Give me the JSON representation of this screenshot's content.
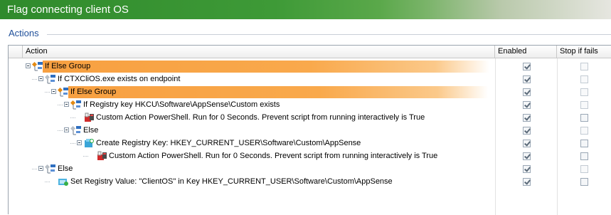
{
  "window": {
    "title": "Flag connecting client OS"
  },
  "section": {
    "label": "Actions"
  },
  "columns": {
    "action": "Action",
    "enabled": "Enabled",
    "stop_if_fails": "Stop if fails"
  },
  "rows": [
    {
      "label": "If Else Group",
      "icon": "if-else-group-icon",
      "highlighted": true,
      "enabled": true,
      "stop_if_fails": false
    },
    {
      "label": "If CTXCliOS.exe exists on endpoint",
      "icon": "condition-icon",
      "highlighted": false,
      "enabled": true,
      "stop_if_fails": false
    },
    {
      "label": "If Else Group",
      "icon": "if-else-group-icon",
      "highlighted": true,
      "enabled": true,
      "stop_if_fails": false
    },
    {
      "label": "If Registry key HKCU\\Software\\AppSense\\Custom exists",
      "icon": "registry-condition-icon",
      "highlighted": false,
      "enabled": true,
      "stop_if_fails": false
    },
    {
      "label": "Custom Action PowerShell. Run for 0 Seconds. Prevent script from running interactively is True",
      "icon": "powershell-icon",
      "highlighted": false,
      "enabled": true,
      "stop_if_fails": false
    },
    {
      "label": "Else",
      "icon": "else-icon",
      "highlighted": false,
      "enabled": true,
      "stop_if_fails": false
    },
    {
      "label": "Create Registry Key: HKEY_CURRENT_USER\\Software\\Custom\\AppSense",
      "icon": "registry-key-icon",
      "highlighted": false,
      "enabled": true,
      "stop_if_fails": false
    },
    {
      "label": "Custom Action PowerShell. Run for 0 Seconds. Prevent script from running interactively is True",
      "icon": "powershell-icon",
      "highlighted": false,
      "enabled": true,
      "stop_if_fails": false
    },
    {
      "label": "Else",
      "icon": "else-icon",
      "highlighted": false,
      "enabled": true,
      "stop_if_fails": false
    },
    {
      "label": "Set Registry Value: \"ClientOS\" in Key HKEY_CURRENT_USER\\Software\\Custom\\AppSense",
      "icon": "registry-value-icon",
      "highlighted": false,
      "enabled": true,
      "stop_if_fails": false
    }
  ]
}
